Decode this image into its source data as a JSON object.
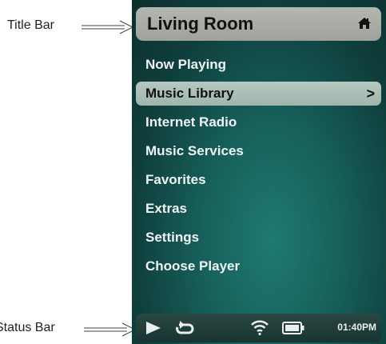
{
  "annotations": {
    "title_bar": "Title Bar",
    "status_bar": "Status Bar"
  },
  "header": {
    "title": "Living Room",
    "icon": "home-icon"
  },
  "menu": {
    "items": [
      {
        "label": "Now Playing"
      },
      {
        "label": "Music Library",
        "selected": true,
        "chevron": ">"
      },
      {
        "label": "Internet Radio"
      },
      {
        "label": "Music Services"
      },
      {
        "label": "Favorites"
      },
      {
        "label": "Extras"
      },
      {
        "label": "Settings"
      },
      {
        "label": "Choose Player"
      }
    ]
  },
  "status": {
    "icons": [
      "play-icon",
      "repeat-icon",
      "wifi-icon",
      "battery-icon"
    ],
    "time": "01:40PM"
  },
  "colors": {
    "background": "#17605b",
    "selected": "#b6c9c1",
    "title_bar": "#b4b6b0",
    "status_bar": "#1e3b38"
  }
}
